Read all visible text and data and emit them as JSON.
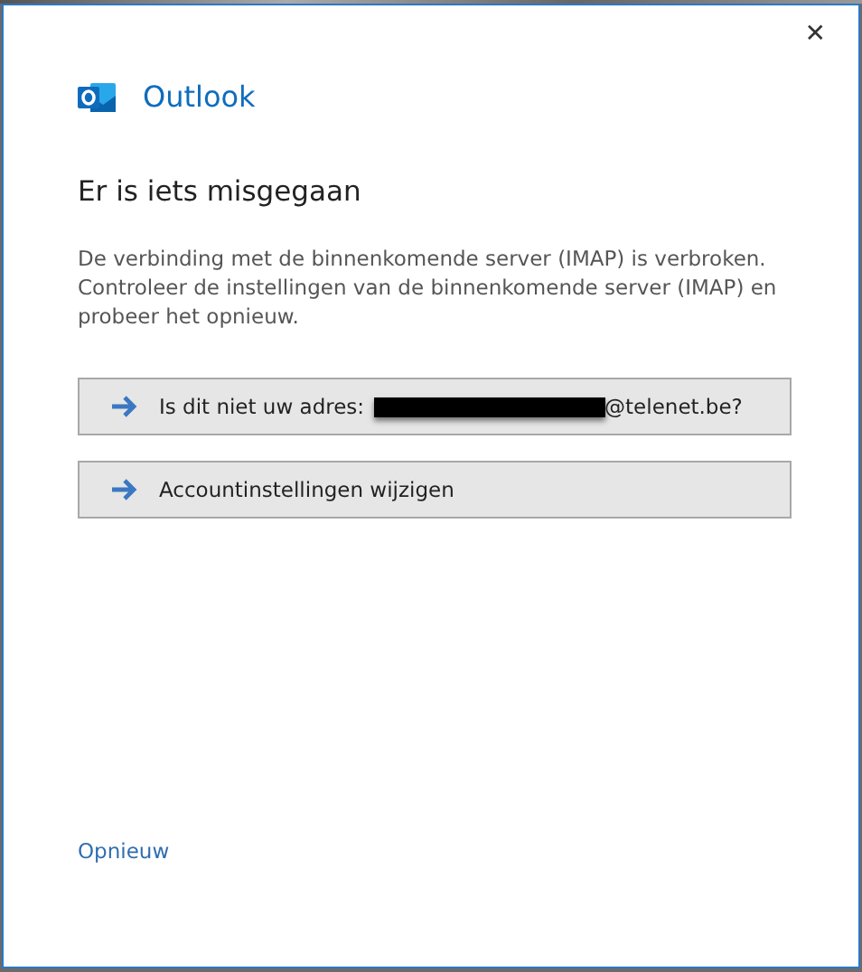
{
  "window": {
    "close": "✕"
  },
  "app": {
    "name": "Outlook"
  },
  "heading": "Er is iets misgegaan",
  "message": "De verbinding met de binnenkomende server (IMAP) is verbroken. Controleer de instellingen van de binnenkomende server (IMAP) en probeer het opnieuw.",
  "buttons": [
    {
      "kind": "address",
      "label": "Is dit niet uw adres:",
      "suffix": "@telenet.be?"
    },
    {
      "kind": "plain",
      "label": "Accountinstellingen wijzigen"
    }
  ],
  "link": "Opnieuw"
}
